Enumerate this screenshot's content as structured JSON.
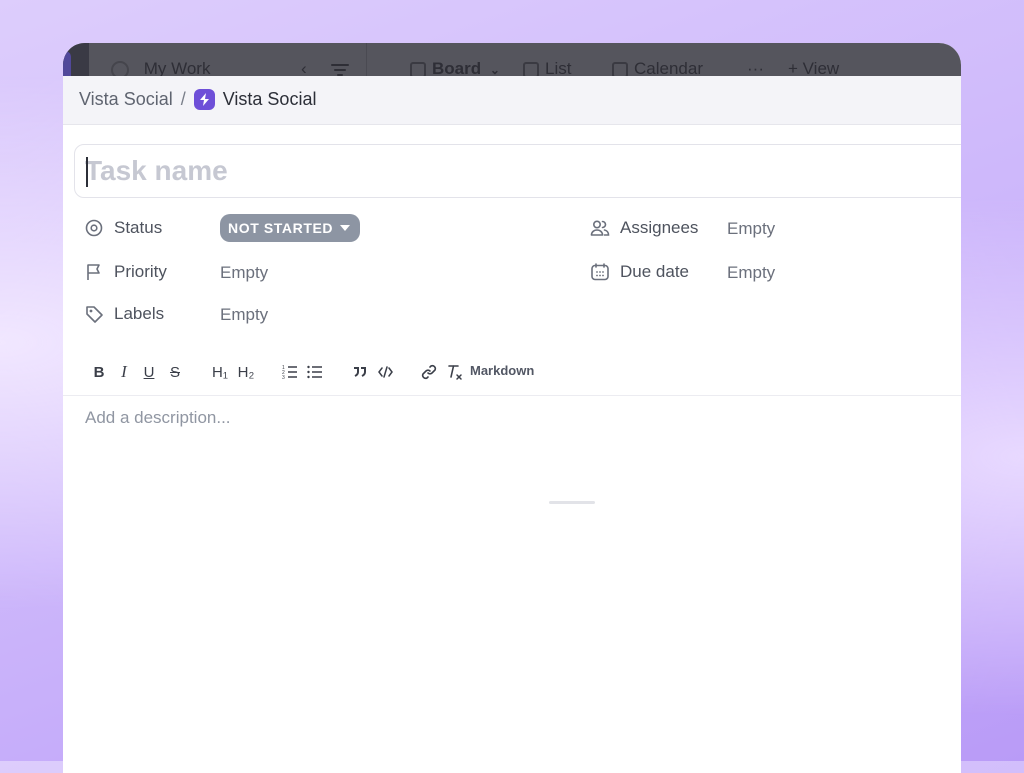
{
  "app_bar": {
    "sidebar_title": "My Work",
    "views": [
      {
        "label": "Board",
        "active": true
      },
      {
        "label": "List",
        "active": false
      },
      {
        "label": "Calendar",
        "active": false
      }
    ],
    "more": "···",
    "add_view": "+ View"
  },
  "breadcrumb": {
    "parent": "Vista Social",
    "separator": "/",
    "current": "Vista Social"
  },
  "task_name": {
    "placeholder": "Task name",
    "value": ""
  },
  "fields": {
    "status": {
      "label": "Status",
      "value": "NOT STARTED"
    },
    "priority": {
      "label": "Priority",
      "value": "Empty"
    },
    "labels": {
      "label": "Labels",
      "value": "Empty"
    },
    "assignees": {
      "label": "Assignees",
      "value": "Empty"
    },
    "due_date": {
      "label": "Due date",
      "value": "Empty"
    }
  },
  "toolbar": {
    "bold": "B",
    "italic": "I",
    "underline": "U",
    "strike": "S",
    "h1": "H₁",
    "h2": "H₂",
    "markdown": "Markdown"
  },
  "description": {
    "placeholder": "Add a description..."
  },
  "colors": {
    "accent": "#6e4fd8",
    "status_pill": "#8d95a3"
  }
}
